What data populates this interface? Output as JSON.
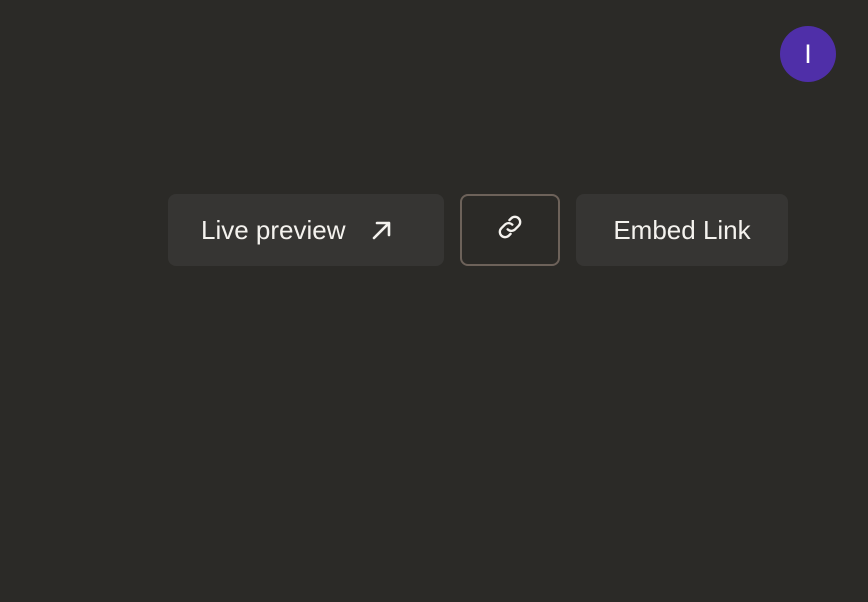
{
  "user": {
    "avatar_initial": "I"
  },
  "actions": {
    "live_preview_label": "Live preview",
    "live_preview_icon": "arrow-up-right-icon",
    "copy_link_icon": "link-icon",
    "embed_link_label": "Embed Link"
  },
  "colors": {
    "background": "#2b2a27",
    "button_bg": "#363533",
    "button_border": "#6d625a",
    "avatar_bg": "#4f2fa8",
    "text": "#f4f2ee"
  }
}
